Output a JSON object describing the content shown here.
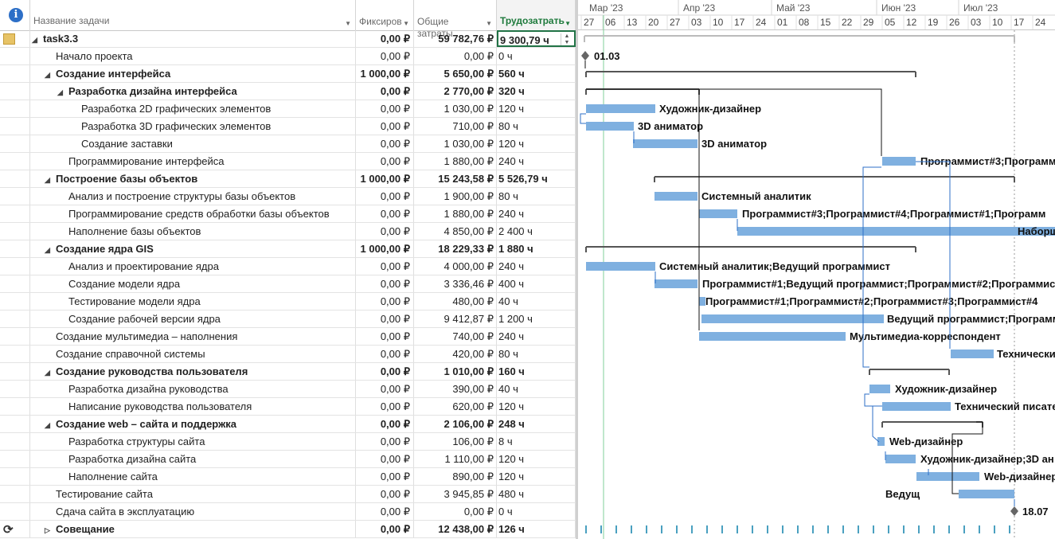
{
  "header": {
    "info_icon": "info-icon",
    "col_name": "Название задачи",
    "col_fixed": "Фиксиров\nзатраты",
    "col_total": "Общие\nзатраты",
    "col_work": "Трудозатрать"
  },
  "timeline": {
    "months": [
      "Мар '23",
      "Апр '23",
      "Май '23",
      "Июн '23",
      "Июл '23"
    ],
    "days": [
      "27",
      "06",
      "13",
      "20",
      "27",
      "03",
      "10",
      "17",
      "24",
      "01",
      "08",
      "15",
      "22",
      "29",
      "05",
      "12",
      "19",
      "26",
      "03",
      "10",
      "17",
      "24"
    ]
  },
  "colors": {
    "bar": "#7fb0e0",
    "summary": "#555555",
    "link": "#2d6fc7",
    "accent": "#1e7a3c"
  },
  "tasks": [
    {
      "name": "task3.3",
      "fixed": "0,00 ₽",
      "total": "59 782,76 ₽",
      "work": "9 300,79 ч",
      "indent": 0,
      "summary": true,
      "collapsed": false,
      "icon": "note-icon"
    },
    {
      "name": "Начало проекта",
      "fixed": "0,00 ₽",
      "total": "0,00 ₽",
      "work": "0 ч",
      "indent": 1,
      "summary": false
    },
    {
      "name": "Создание интерфейса",
      "fixed": "1 000,00 ₽",
      "total": "5 650,00 ₽",
      "work": "560 ч",
      "indent": 1,
      "summary": true,
      "collapsed": false
    },
    {
      "name": "Разработка дизайна интерфейса",
      "fixed": "0,00 ₽",
      "total": "2 770,00 ₽",
      "work": "320 ч",
      "indent": 2,
      "summary": true,
      "collapsed": false
    },
    {
      "name": "Разработка 2D графических элементов",
      "fixed": "0,00 ₽",
      "total": "1 030,00 ₽",
      "work": "120 ч",
      "indent": 3,
      "summary": false
    },
    {
      "name": "Разработка 3D графических элементов",
      "fixed": "0,00 ₽",
      "total": "710,00 ₽",
      "work": "80 ч",
      "indent": 3,
      "summary": false
    },
    {
      "name": "Создание заставки",
      "fixed": "0,00 ₽",
      "total": "1 030,00 ₽",
      "work": "120 ч",
      "indent": 3,
      "summary": false
    },
    {
      "name": "Программирование интерфейса",
      "fixed": "0,00 ₽",
      "total": "1 880,00 ₽",
      "work": "240 ч",
      "indent": 2,
      "summary": false
    },
    {
      "name": "Построение базы объектов",
      "fixed": "1 000,00 ₽",
      "total": "15 243,58 ₽",
      "work": "5 526,79 ч",
      "indent": 1,
      "summary": true,
      "collapsed": false
    },
    {
      "name": "Анализ и построение структуры базы объектов",
      "fixed": "0,00 ₽",
      "total": "1 900,00 ₽",
      "work": "80 ч",
      "indent": 2,
      "summary": false
    },
    {
      "name": "Программирование средств обработки базы объектов",
      "fixed": "0,00 ₽",
      "total": "1 880,00 ₽",
      "work": "240 ч",
      "indent": 2,
      "summary": false
    },
    {
      "name": "Наполнение базы объектов",
      "fixed": "0,00 ₽",
      "total": "4 850,00 ₽",
      "work": "2 400 ч",
      "indent": 2,
      "summary": false
    },
    {
      "name": "Создание ядра GIS",
      "fixed": "1 000,00 ₽",
      "total": "18 229,33 ₽",
      "work": "1 880 ч",
      "indent": 1,
      "summary": true,
      "collapsed": false
    },
    {
      "name": "Анализ и проектирование ядра",
      "fixed": "0,00 ₽",
      "total": "4 000,00 ₽",
      "work": "240 ч",
      "indent": 2,
      "summary": false
    },
    {
      "name": "Создание модели ядра",
      "fixed": "0,00 ₽",
      "total": "3 336,46 ₽",
      "work": "400 ч",
      "indent": 2,
      "summary": false
    },
    {
      "name": "Тестирование модели ядра",
      "fixed": "0,00 ₽",
      "total": "480,00 ₽",
      "work": "40 ч",
      "indent": 2,
      "summary": false
    },
    {
      "name": "Создание рабочей версии ядра",
      "fixed": "0,00 ₽",
      "total": "9 412,87 ₽",
      "work": "1 200 ч",
      "indent": 2,
      "summary": false
    },
    {
      "name": "Создание мультимедиа – наполнения",
      "fixed": "0,00 ₽",
      "total": "740,00 ₽",
      "work": "240 ч",
      "indent": 1,
      "summary": false
    },
    {
      "name": "Создание справочной системы",
      "fixed": "0,00 ₽",
      "total": "420,00 ₽",
      "work": "80 ч",
      "indent": 1,
      "summary": false
    },
    {
      "name": "Создание руководства пользователя",
      "fixed": "0,00 ₽",
      "total": "1 010,00 ₽",
      "work": "160 ч",
      "indent": 1,
      "summary": true,
      "collapsed": false
    },
    {
      "name": "Разработка дизайна руководства",
      "fixed": "0,00 ₽",
      "total": "390,00 ₽",
      "work": "40 ч",
      "indent": 2,
      "summary": false
    },
    {
      "name": "Написание руководства пользователя",
      "fixed": "0,00 ₽",
      "total": "620,00 ₽",
      "work": "120 ч",
      "indent": 2,
      "summary": false
    },
    {
      "name": "Создание web – сайта и поддержка",
      "fixed": "0,00 ₽",
      "total": "2 106,00 ₽",
      "work": "248 ч",
      "indent": 1,
      "summary": true,
      "collapsed": false
    },
    {
      "name": "Разработка структуры сайта",
      "fixed": "0,00 ₽",
      "total": "106,00 ₽",
      "work": "8 ч",
      "indent": 2,
      "summary": false
    },
    {
      "name": "Разработка дизайна сайта",
      "fixed": "0,00 ₽",
      "total": "1 110,00 ₽",
      "work": "120 ч",
      "indent": 2,
      "summary": false
    },
    {
      "name": "Наполнение сайта",
      "fixed": "0,00 ₽",
      "total": "890,00 ₽",
      "work": "120 ч",
      "indent": 2,
      "summary": false
    },
    {
      "name": "Тестирование сайта",
      "fixed": "0,00 ₽",
      "total": "3 945,85 ₽",
      "work": "480 ч",
      "indent": 1,
      "summary": false
    },
    {
      "name": "Сдача сайта в эксплуатацию",
      "fixed": "0,00 ₽",
      "total": "0,00 ₽",
      "work": "0 ч",
      "indent": 1,
      "summary": false
    },
    {
      "name": "Совещание",
      "fixed": "0,00 ₽",
      "total": "12 438,00 ₽",
      "work": "126 ч",
      "indent": 1,
      "summary": true,
      "collapsed": true,
      "icon": "recurring-icon"
    }
  ],
  "gantt_labels": [
    "01.03",
    "Художник-дизайнер",
    "3D аниматор",
    "3D аниматор",
    "Программист#3;Программ",
    "Системный аналитик",
    "Программист#3;Программист#4;Программист#1;Программ",
    "Наборщ",
    "Системный аналитик;Ведущий программист",
    "Программист#1;Ведущий программист;Программист#2;Программист",
    "Программист#1;Программист#2;Программист#3;Программист#4",
    "Ведущий программист;Программ",
    "Мультимедиа-корреспондент",
    "Технически",
    "Художник-дизайнер",
    "Технический писате",
    "Web-дизайнер",
    "Художник-дизайнер;3D ан",
    "Web-дизайнер",
    "Ведущ",
    "18.07"
  ]
}
